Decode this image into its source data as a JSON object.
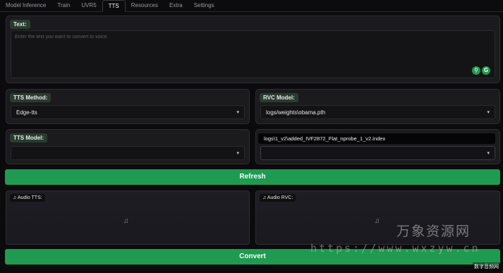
{
  "tabs": [
    "Model Inference",
    "Train",
    "UVR5",
    "TTS",
    "Resources",
    "Extra",
    "Settings"
  ],
  "active_tab": "TTS",
  "text_panel": {
    "label": "Text:",
    "placeholder": "Enter the text you want to convert to voice."
  },
  "tts_method": {
    "label": "TTS Method:",
    "value": "Edge-tts"
  },
  "rvc_model": {
    "label": "RVC Model:",
    "value": "logs/weights\\obama.pth"
  },
  "tts_model": {
    "label": "TTS Model:",
    "value": ""
  },
  "index_file": {
    "tooltip": "logs\\1_v2\\added_IVF2872_Flat_nprobe_1_v2.index",
    "value": ""
  },
  "refresh_button": "Refresh",
  "audio_tts": {
    "label": "Audio TTS:"
  },
  "audio_rvc": {
    "label": "Audio RVC:"
  },
  "convert_button": "Convert",
  "icons": {
    "caret": "▾",
    "music": "♫",
    "grammarly": "G",
    "pin": "⚲"
  },
  "watermark": {
    "chinese": "万象资源网",
    "url": "https://www.wxzyw.cn",
    "corner": "数字音频网"
  }
}
